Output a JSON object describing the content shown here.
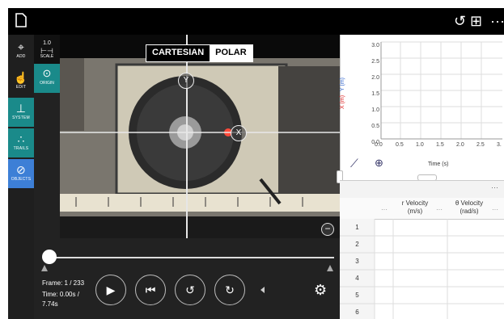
{
  "toolbar": {
    "left_icon": "new-document-icon",
    "reset_icon": "↺",
    "layout_icon": "⊞",
    "more_icon": "···"
  },
  "tools": {
    "add": "ADD",
    "edit": "EDIT",
    "system": "SYSTEM",
    "trails": "TRAILS",
    "objects": "OBJECTS"
  },
  "subtools": {
    "scale_value": "1.0",
    "scale": "SCALE",
    "origin": "ORIGIN"
  },
  "coord_toggle": {
    "cartesian": "CARTESIAN",
    "polar": "POLAR",
    "selected": "POLAR"
  },
  "axis_markers": {
    "y": "Y",
    "x": "X"
  },
  "playback": {
    "frame_label": "Frame: 1 / 233",
    "time_label": "Time: 0.00s /",
    "total_time": "7.74s",
    "progress_fraction": 0.0
  },
  "graph": {
    "y_axis_title_x": "X (m)",
    "y_axis_title_y": "Y (m)",
    "y_ticks": [
      "3.0",
      "2.5",
      "2.0",
      "1.5",
      "1.0",
      "0.5",
      "0.0"
    ],
    "x_ticks": [
      "0.0",
      "0.5",
      "1.0",
      "1.5",
      "2.0",
      "2.5",
      "3."
    ],
    "x_label": "Time (s)",
    "colors": {
      "x_axis_label": "#d22",
      "y_axis_label": "#36c"
    }
  },
  "table": {
    "more": "···",
    "col1_title": "r Velocity",
    "col1_unit": "(m/s)",
    "col2_title": "θ Velocity",
    "col2_unit": "(rad/s)",
    "rows": [
      "1",
      "2",
      "3",
      "4",
      "5",
      "6"
    ]
  }
}
